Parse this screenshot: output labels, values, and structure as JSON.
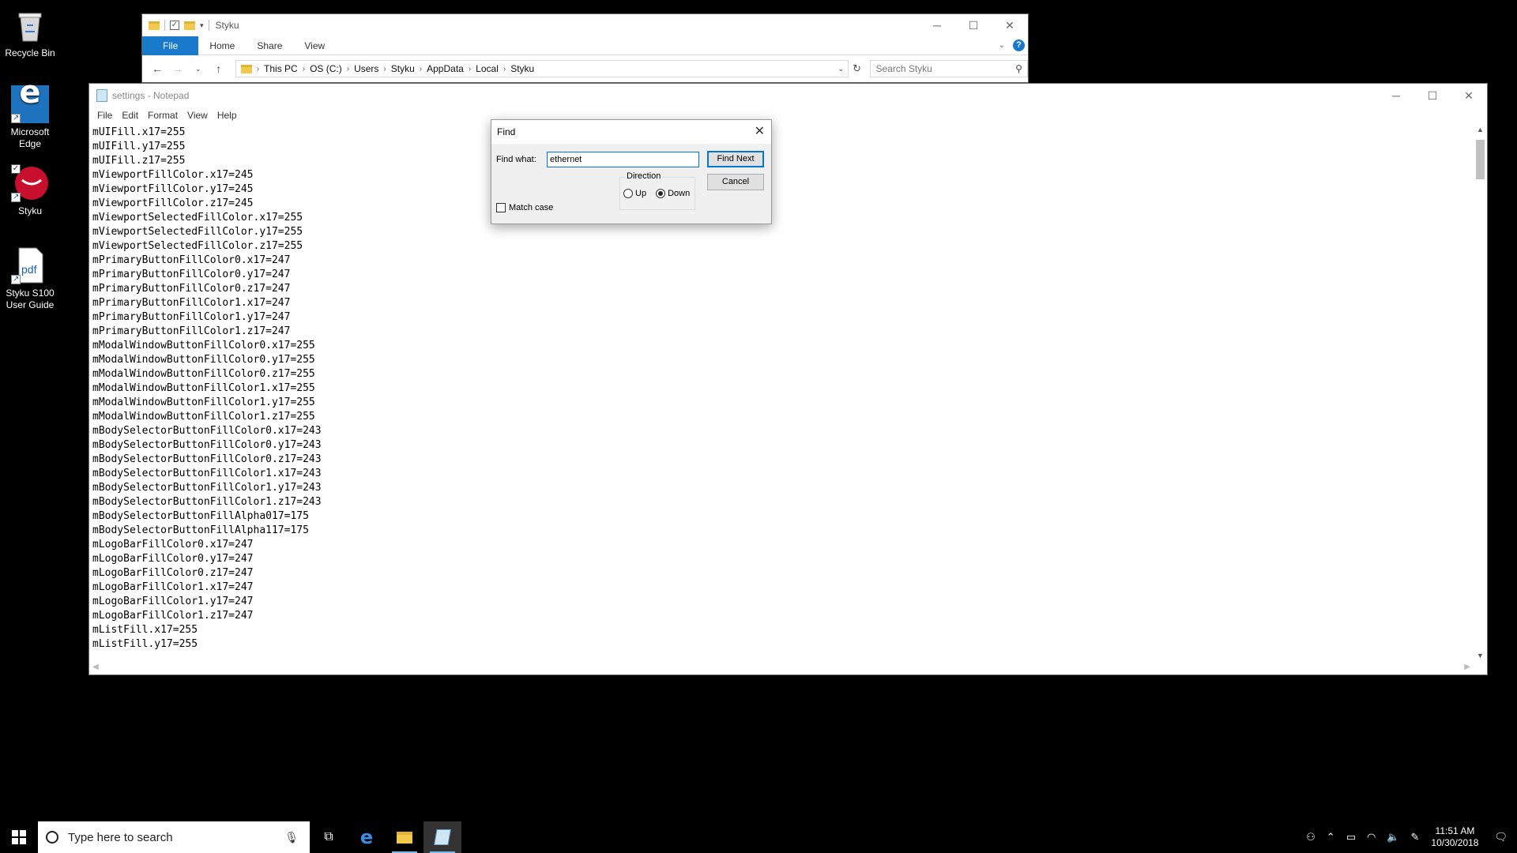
{
  "desktop": {
    "icons": [
      {
        "label": "Recycle Bin",
        "icon": "recycle-bin-icon"
      },
      {
        "label": "Microsoft Edge",
        "icon": "edge-icon"
      },
      {
        "label": "Styku",
        "icon": "styku-icon"
      },
      {
        "label": "Styku S100 User Guide",
        "icon": "pdf-icon",
        "badge": "pdf"
      }
    ]
  },
  "explorer": {
    "title": "Styku",
    "tabs": [
      "File",
      "Home",
      "Share",
      "View"
    ],
    "breadcrumb": [
      "This PC",
      "OS (C:)",
      "Users",
      "Styku",
      "AppData",
      "Local",
      "Styku"
    ],
    "search_placeholder": "Search Styku",
    "help": "?"
  },
  "notepad": {
    "title": "settings - Notepad",
    "menu": [
      "File",
      "Edit",
      "Format",
      "View",
      "Help"
    ],
    "lines": [
      "mUIFill.x17=255",
      "mUIFill.y17=255",
      "mUIFill.z17=255",
      "mViewportFillColor.x17=245",
      "mViewportFillColor.y17=245",
      "mViewportFillColor.z17=245",
      "mViewportSelectedFillColor.x17=255",
      "mViewportSelectedFillColor.y17=255",
      "mViewportSelectedFillColor.z17=255",
      "mPrimaryButtonFillColor0.x17=247",
      "mPrimaryButtonFillColor0.y17=247",
      "mPrimaryButtonFillColor0.z17=247",
      "mPrimaryButtonFillColor1.x17=247",
      "mPrimaryButtonFillColor1.y17=247",
      "mPrimaryButtonFillColor1.z17=247",
      "mModalWindowButtonFillColor0.x17=255",
      "mModalWindowButtonFillColor0.y17=255",
      "mModalWindowButtonFillColor0.z17=255",
      "mModalWindowButtonFillColor1.x17=255",
      "mModalWindowButtonFillColor1.y17=255",
      "mModalWindowButtonFillColor1.z17=255",
      "mBodySelectorButtonFillColor0.x17=243",
      "mBodySelectorButtonFillColor0.y17=243",
      "mBodySelectorButtonFillColor0.z17=243",
      "mBodySelectorButtonFillColor1.x17=243",
      "mBodySelectorButtonFillColor1.y17=243",
      "mBodySelectorButtonFillColor1.z17=243",
      "mBodySelectorButtonFillAlpha017=175",
      "mBodySelectorButtonFillAlpha117=175",
      "mLogoBarFillColor0.x17=247",
      "mLogoBarFillColor0.y17=247",
      "mLogoBarFillColor0.z17=247",
      "mLogoBarFillColor1.x17=247",
      "mLogoBarFillColor1.y17=247",
      "mLogoBarFillColor1.z17=247",
      "mListFill.x17=255",
      "mListFill.y17=255"
    ]
  },
  "find_dialog": {
    "title": "Find",
    "find_what_label": "Find what:",
    "find_what_value": "ethernet",
    "find_next_label": "Find Next",
    "cancel_label": "Cancel",
    "direction_label": "Direction",
    "up_label": "Up",
    "down_label": "Down",
    "direction_selected": "Down",
    "match_case_label": "Match case",
    "match_case_checked": false
  },
  "taskbar": {
    "search_placeholder": "Type here to search",
    "time": "11:51 AM",
    "date": "10/30/2018"
  },
  "colors": {
    "accent": "#1979ca",
    "focus": "#0078d7",
    "desktop": "#000000"
  }
}
